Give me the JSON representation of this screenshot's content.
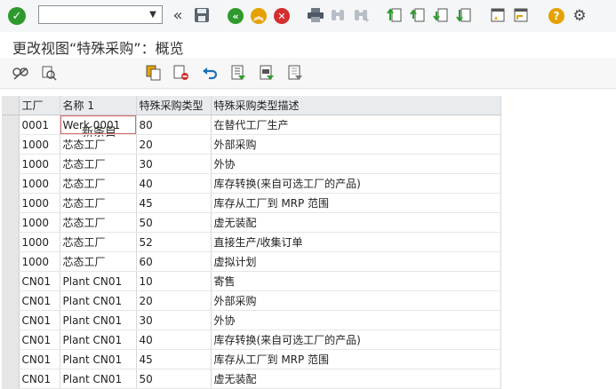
{
  "toolbar": {
    "command_value": "",
    "icons": [
      "check-icon",
      "command-dropdown-icon",
      "back-collapse-icon",
      "save-icon",
      "nav-back-icon",
      "nav-exit-icon",
      "nav-cancel-icon",
      "print-icon",
      "find-icon",
      "find-next-icon",
      "first-page-icon",
      "previous-page-icon",
      "next-page-icon",
      "last-page-icon",
      "create-session-icon",
      "shortcut-icon",
      "help-icon",
      "settings-icon"
    ]
  },
  "title": "更改视图“特殊采购”：概览",
  "toolbar2": {
    "new_entries_label": "新条目",
    "icons": [
      "display-change-icon",
      "other-view-icon",
      "copy-icon",
      "delete-icon",
      "undo-icon",
      "select-all-icon",
      "select-block-icon",
      "deselect-all-icon"
    ]
  },
  "table": {
    "columns": [
      "工厂",
      "名称 1",
      "特殊采购类型",
      "特殊采购类型描述"
    ],
    "rows": [
      [
        "0001",
        "Werk 0001",
        "80",
        "在替代工厂生产"
      ],
      [
        "1000",
        "芯态工厂",
        "20",
        "外部采购"
      ],
      [
        "1000",
        "芯态工厂",
        "30",
        "外协"
      ],
      [
        "1000",
        "芯态工厂",
        "40",
        "库存转换(来自可选工厂的产品)"
      ],
      [
        "1000",
        "芯态工厂",
        "45",
        "库存从工厂到 MRP 范围"
      ],
      [
        "1000",
        "芯态工厂",
        "50",
        "虚无装配"
      ],
      [
        "1000",
        "芯态工厂",
        "52",
        "直接生产/收集订单"
      ],
      [
        "1000",
        "芯态工厂",
        "60",
        "虚拟计划"
      ],
      [
        "CN01",
        "Plant CN01",
        "10",
        "寄售"
      ],
      [
        "CN01",
        "Plant CN01",
        "20",
        "外部采购"
      ],
      [
        "CN01",
        "Plant CN01",
        "30",
        "外协"
      ],
      [
        "CN01",
        "Plant CN01",
        "40",
        "库存转换(来自可选工厂的产品)"
      ],
      [
        "CN01",
        "Plant CN01",
        "45",
        "库存从工厂到 MRP 范围"
      ],
      [
        "CN01",
        "Plant CN01",
        "50",
        "虚无装配"
      ]
    ]
  }
}
